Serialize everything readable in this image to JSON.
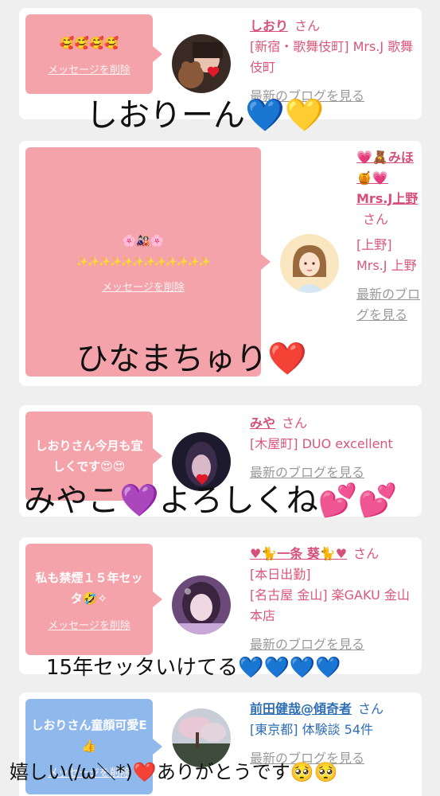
{
  "common": {
    "delete_label": "メッセージを削除",
    "san": "さん",
    "blog_label": "最新のブログを見る"
  },
  "cards": [
    {
      "bubble_text": "🥰🥰🥰🥰",
      "name": "しおり",
      "shop": "[新宿・歌舞伎町] Mrs.J 歌舞伎町",
      "blog": "最新のブログを見る",
      "overlay": "しおりーん",
      "overlay_emoji": "💙💛"
    },
    {
      "bubble_text_1": "🌸🎎🌸",
      "bubble_text_2": "✨✨✨✨✨✨✨✨✨✨✨✨",
      "name": "💗🧸みほ🍯💗Mrs.J上野",
      "shop": "[上野] Mrs.J 上野",
      "blog": "最新のブログを見る",
      "overlay": "ひなまちゅり",
      "overlay_emoji": "❤️"
    },
    {
      "bubble_text": "しおりさん今月も宜しくです😍😍",
      "name": "みや",
      "shop": "[木屋町] DUO excellent",
      "blog": "最新のブログを見る",
      "overlay": "みやこ",
      "overlay_emoji_1": "💜",
      "overlay_2": "よろしくね",
      "overlay_emoji_2": "💕💕"
    },
    {
      "bubble_text": "私も禁煙１５年セッタ🤣✧",
      "name": "♥🐈一条 葵🐈♥",
      "shop_1": "[本日出勤]",
      "shop_2": "[名古屋 金山] 楽GAKU 金山本店",
      "blog": "最新のブログを見る",
      "overlay": "15年セッタいけてる",
      "overlay_emoji": "💙💙💙💙"
    },
    {
      "bubble_text": "しおりさん童顔可愛E👍",
      "name": "前田健哉@傾奇者",
      "shop": "[東京都] 体験談 54件",
      "blog": "最新のブログを見る",
      "overlay": "嬉しい(/ω＼*)",
      "overlay_emoji_1": "❤️",
      "overlay_2": "ありがとうです",
      "overlay_emoji_2": "🥺🥺"
    }
  ]
}
